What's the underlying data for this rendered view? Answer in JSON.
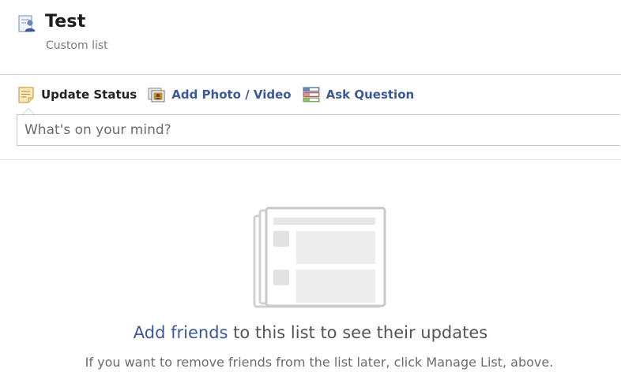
{
  "header": {
    "title": "Test",
    "subtitle": "Custom list",
    "icon": "custom-list-icon"
  },
  "composer": {
    "tabs": [
      {
        "label": "Update Status",
        "icon": "status-note-icon",
        "active": true
      },
      {
        "label": "Add Photo / Video",
        "icon": "photo-icon",
        "active": false
      },
      {
        "label": "Ask Question",
        "icon": "question-icon",
        "active": false
      }
    ],
    "placeholder": "What's on your mind?"
  },
  "empty_state": {
    "link_text": "Add friends",
    "message_rest": " to this list to see their updates",
    "hint": "If you want to remove friends from the list later, click Manage List, above."
  },
  "colors": {
    "link": "#3b5998",
    "border": "#bdc7d8",
    "illustration": "#cccccc"
  }
}
